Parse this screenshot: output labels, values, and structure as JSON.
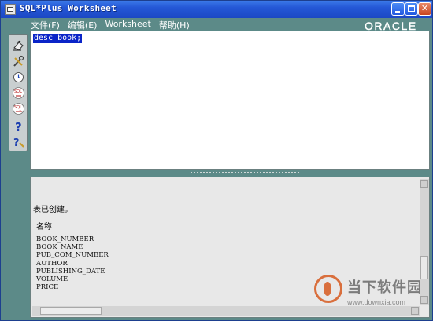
{
  "window": {
    "title": "SQL*Plus Worksheet",
    "brand_logo": "ORACLE"
  },
  "menu": {
    "items": [
      {
        "label": "文件(F)"
      },
      {
        "label": "编辑(E)"
      },
      {
        "label": "Worksheet"
      },
      {
        "label": "帮助(H)"
      }
    ]
  },
  "toolbar": {
    "tools": [
      {
        "icon": "eraser-icon"
      },
      {
        "icon": "wrench-icon"
      },
      {
        "icon": "history-icon"
      },
      {
        "icon": "sql-previous-icon"
      },
      {
        "icon": "sql-next-icon"
      },
      {
        "icon": "help-icon"
      },
      {
        "icon": "help-context-icon"
      }
    ]
  },
  "editor": {
    "text": "desc book;"
  },
  "output": {
    "status": "表已创建。",
    "header": "名称",
    "columns": [
      "BOOK_NUMBER",
      "BOOK_NAME",
      "PUB_COM_NUMBER",
      "AUTHOR",
      "PUBLISHING_DATE",
      "VOLUME",
      "PRICE"
    ]
  },
  "watermark": {
    "brand": "当下软件园",
    "url": "www.downxia.com"
  },
  "colors": {
    "background": "#5c8a88",
    "titlebar": "#2457d6",
    "selection": "#0a24c8"
  }
}
